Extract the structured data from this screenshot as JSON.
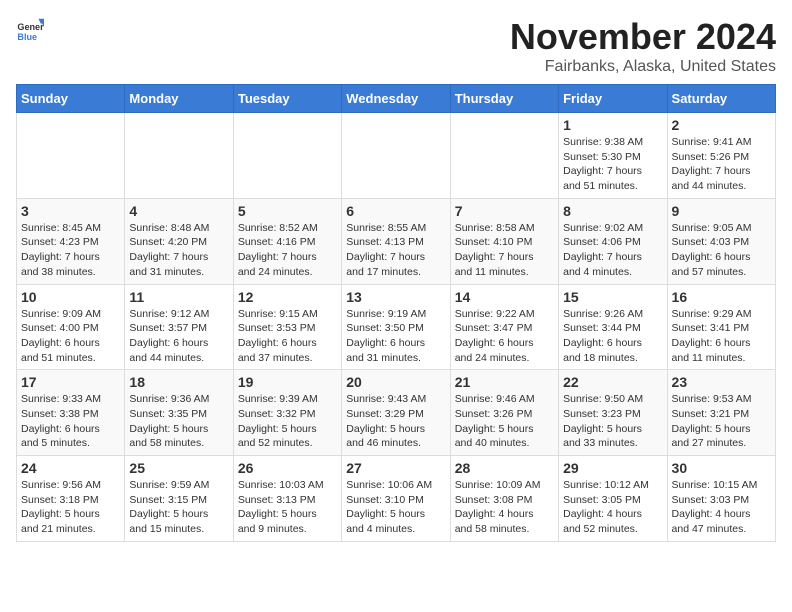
{
  "header": {
    "logo_general": "General",
    "logo_blue": "Blue",
    "month_title": "November 2024",
    "location": "Fairbanks, Alaska, United States"
  },
  "days_of_week": [
    "Sunday",
    "Monday",
    "Tuesday",
    "Wednesday",
    "Thursday",
    "Friday",
    "Saturday"
  ],
  "weeks": [
    [
      {
        "day": "",
        "info": ""
      },
      {
        "day": "",
        "info": ""
      },
      {
        "day": "",
        "info": ""
      },
      {
        "day": "",
        "info": ""
      },
      {
        "day": "",
        "info": ""
      },
      {
        "day": "1",
        "info": "Sunrise: 9:38 AM\nSunset: 5:30 PM\nDaylight: 7 hours\nand 51 minutes."
      },
      {
        "day": "2",
        "info": "Sunrise: 9:41 AM\nSunset: 5:26 PM\nDaylight: 7 hours\nand 44 minutes."
      }
    ],
    [
      {
        "day": "3",
        "info": "Sunrise: 8:45 AM\nSunset: 4:23 PM\nDaylight: 7 hours\nand 38 minutes."
      },
      {
        "day": "4",
        "info": "Sunrise: 8:48 AM\nSunset: 4:20 PM\nDaylight: 7 hours\nand 31 minutes."
      },
      {
        "day": "5",
        "info": "Sunrise: 8:52 AM\nSunset: 4:16 PM\nDaylight: 7 hours\nand 24 minutes."
      },
      {
        "day": "6",
        "info": "Sunrise: 8:55 AM\nSunset: 4:13 PM\nDaylight: 7 hours\nand 17 minutes."
      },
      {
        "day": "7",
        "info": "Sunrise: 8:58 AM\nSunset: 4:10 PM\nDaylight: 7 hours\nand 11 minutes."
      },
      {
        "day": "8",
        "info": "Sunrise: 9:02 AM\nSunset: 4:06 PM\nDaylight: 7 hours\nand 4 minutes."
      },
      {
        "day": "9",
        "info": "Sunrise: 9:05 AM\nSunset: 4:03 PM\nDaylight: 6 hours\nand 57 minutes."
      }
    ],
    [
      {
        "day": "10",
        "info": "Sunrise: 9:09 AM\nSunset: 4:00 PM\nDaylight: 6 hours\nand 51 minutes."
      },
      {
        "day": "11",
        "info": "Sunrise: 9:12 AM\nSunset: 3:57 PM\nDaylight: 6 hours\nand 44 minutes."
      },
      {
        "day": "12",
        "info": "Sunrise: 9:15 AM\nSunset: 3:53 PM\nDaylight: 6 hours\nand 37 minutes."
      },
      {
        "day": "13",
        "info": "Sunrise: 9:19 AM\nSunset: 3:50 PM\nDaylight: 6 hours\nand 31 minutes."
      },
      {
        "day": "14",
        "info": "Sunrise: 9:22 AM\nSunset: 3:47 PM\nDaylight: 6 hours\nand 24 minutes."
      },
      {
        "day": "15",
        "info": "Sunrise: 9:26 AM\nSunset: 3:44 PM\nDaylight: 6 hours\nand 18 minutes."
      },
      {
        "day": "16",
        "info": "Sunrise: 9:29 AM\nSunset: 3:41 PM\nDaylight: 6 hours\nand 11 minutes."
      }
    ],
    [
      {
        "day": "17",
        "info": "Sunrise: 9:33 AM\nSunset: 3:38 PM\nDaylight: 6 hours\nand 5 minutes."
      },
      {
        "day": "18",
        "info": "Sunrise: 9:36 AM\nSunset: 3:35 PM\nDaylight: 5 hours\nand 58 minutes."
      },
      {
        "day": "19",
        "info": "Sunrise: 9:39 AM\nSunset: 3:32 PM\nDaylight: 5 hours\nand 52 minutes."
      },
      {
        "day": "20",
        "info": "Sunrise: 9:43 AM\nSunset: 3:29 PM\nDaylight: 5 hours\nand 46 minutes."
      },
      {
        "day": "21",
        "info": "Sunrise: 9:46 AM\nSunset: 3:26 PM\nDaylight: 5 hours\nand 40 minutes."
      },
      {
        "day": "22",
        "info": "Sunrise: 9:50 AM\nSunset: 3:23 PM\nDaylight: 5 hours\nand 33 minutes."
      },
      {
        "day": "23",
        "info": "Sunrise: 9:53 AM\nSunset: 3:21 PM\nDaylight: 5 hours\nand 27 minutes."
      }
    ],
    [
      {
        "day": "24",
        "info": "Sunrise: 9:56 AM\nSunset: 3:18 PM\nDaylight: 5 hours\nand 21 minutes."
      },
      {
        "day": "25",
        "info": "Sunrise: 9:59 AM\nSunset: 3:15 PM\nDaylight: 5 hours\nand 15 minutes."
      },
      {
        "day": "26",
        "info": "Sunrise: 10:03 AM\nSunset: 3:13 PM\nDaylight: 5 hours\nand 9 minutes."
      },
      {
        "day": "27",
        "info": "Sunrise: 10:06 AM\nSunset: 3:10 PM\nDaylight: 5 hours\nand 4 minutes."
      },
      {
        "day": "28",
        "info": "Sunrise: 10:09 AM\nSunset: 3:08 PM\nDaylight: 4 hours\nand 58 minutes."
      },
      {
        "day": "29",
        "info": "Sunrise: 10:12 AM\nSunset: 3:05 PM\nDaylight: 4 hours\nand 52 minutes."
      },
      {
        "day": "30",
        "info": "Sunrise: 10:15 AM\nSunset: 3:03 PM\nDaylight: 4 hours\nand 47 minutes."
      }
    ]
  ]
}
